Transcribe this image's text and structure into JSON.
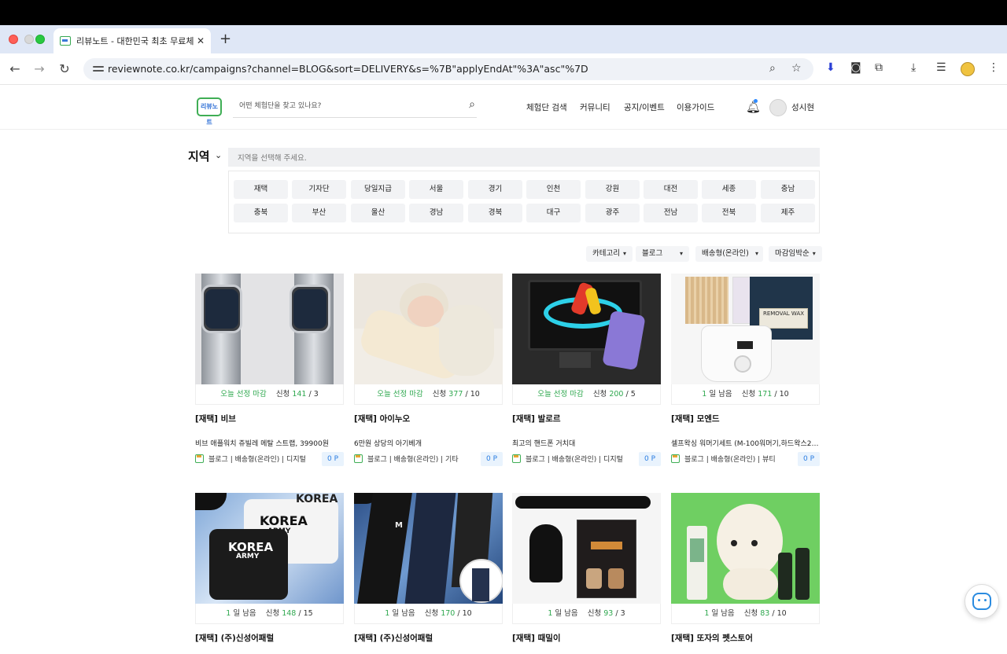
{
  "browser": {
    "tab_title": "리뷰노트 - 대한민국 최초 무료체험",
    "tab_close": "✕",
    "new_tab": "+",
    "url": "reviewnote.co.kr/campaigns?channel=BLOG&sort=DELIVERY&s=%7B\"applyEndAt\"%3A\"asc\"%7D"
  },
  "header": {
    "logo_text": "리뷰노트",
    "search_placeholder": "어떤 체험단을 찾고 있나요?",
    "nav": [
      "체험단 검색",
      "커뮤니티",
      "공지/이벤트",
      "이용가이드"
    ],
    "user_name": "성시현"
  },
  "region": {
    "label": "지역",
    "placeholder": "지역을 선택해 주세요.",
    "chips": [
      "재택",
      "기자단",
      "당일지급",
      "서울",
      "경기",
      "인천",
      "강원",
      "대전",
      "세종",
      "충남",
      "충북",
      "부산",
      "울산",
      "경남",
      "경북",
      "대구",
      "광주",
      "전남",
      "전북",
      "제주"
    ]
  },
  "sort": {
    "category": "카테고리",
    "channel": "블로그",
    "type": "배송형(온라인)",
    "order": "마감임박순"
  },
  "cards": [
    {
      "status": "오늘 선정 마감",
      "status_green": true,
      "apply_label": "신청",
      "applied": "141",
      "cap": "3",
      "title": "[재택] 비브",
      "desc": "비브 애플워치 쥬빌레 메탈 스트랩, 39900원",
      "meta": "블로그 | 배송형(온라인) | 디지털",
      "points": "0 P"
    },
    {
      "status": "오늘 선정 마감",
      "status_green": true,
      "apply_label": "신청",
      "applied": "377",
      "cap": "10",
      "title": "[재택] 아이누오",
      "desc": "6만원 상당의 아기베개",
      "meta": "블로그 | 배송형(온라인) | 기타",
      "points": "0 P"
    },
    {
      "status": "오늘 선정 마감",
      "status_green": true,
      "apply_label": "신청",
      "applied": "200",
      "cap": "5",
      "title": "[재택] 발로르",
      "desc": "최고의 핸드폰 거치대",
      "meta": "블로그 | 배송형(온라인) | 디지털",
      "points": "0 P"
    },
    {
      "status": "1",
      "status_suffix": " 일 남음",
      "status_green": false,
      "apply_label": "신청",
      "applied": "171",
      "cap": "10",
      "title": "[재택] 모엔드",
      "desc": "셀프왁싱 워머기세트 (M-100워머기,하드왁스2…",
      "meta": "블로그 | 배송형(온라인) | 뷰티",
      "points": "0 P"
    },
    {
      "status": "1",
      "status_suffix": " 일 남음",
      "status_green": false,
      "apply_label": "신청",
      "applied": "148",
      "cap": "15",
      "title": "[재택] (주)신성어패럴"
    },
    {
      "status": "1",
      "status_suffix": " 일 남음",
      "status_green": false,
      "apply_label": "신청",
      "applied": "170",
      "cap": "10",
      "title": "[재택] (주)신성어패럴"
    },
    {
      "status": "1",
      "status_suffix": " 일 남음",
      "status_green": false,
      "apply_label": "신청",
      "applied": "93",
      "cap": "3",
      "title": "[재택] 때밀이"
    },
    {
      "status": "1",
      "status_suffix": " 일 남음",
      "status_green": false,
      "apply_label": "신청",
      "applied": "83",
      "cap": "10",
      "title": "[재택] 또자의 펫스토어"
    }
  ],
  "image_text": {
    "shirt_a": "KOREA",
    "shirt_b": "ARMY",
    "wax_label": "REMOVAL WAX",
    "pants_logo": "M"
  },
  "colors": {
    "accent_green": "#2fa84f",
    "points_blue": "#2a7de1"
  }
}
